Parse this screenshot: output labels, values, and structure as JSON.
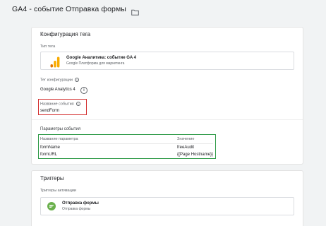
{
  "header": {
    "title": "GA4 - событие Отправка формы",
    "folder_icon": "folder-icon"
  },
  "config": {
    "title": "Конфигурация тега",
    "tag_type_label": "Тип тега",
    "tag_name": "Google Аналитика: событие GA 4",
    "tag_subtitle": "Google Платформа для маркетинга",
    "config_tag_label": "Тег конфигурации",
    "config_tag_value": "Google Analytics 4",
    "event_name_label": "Название события",
    "event_name_value": "sendForm",
    "params_title": "Параметры события",
    "params_col_name": "Название параметра",
    "params_col_value": "Значение",
    "params": [
      {
        "name": "formName",
        "value": "freeAudit"
      },
      {
        "name": "formURL",
        "value": "{{Page Hostname}}"
      }
    ]
  },
  "triggers": {
    "title": "Триггеры",
    "label": "Триггеры активации",
    "items": [
      {
        "name": "Отправка формы",
        "type": "Отправка формы"
      }
    ]
  },
  "colors": {
    "highlight_red": "#d32f2f",
    "highlight_green": "#2e9a47",
    "ga_orange": "#f9ab00",
    "ga_dark_orange": "#e37400",
    "trigger_green": "#6ab04c"
  }
}
